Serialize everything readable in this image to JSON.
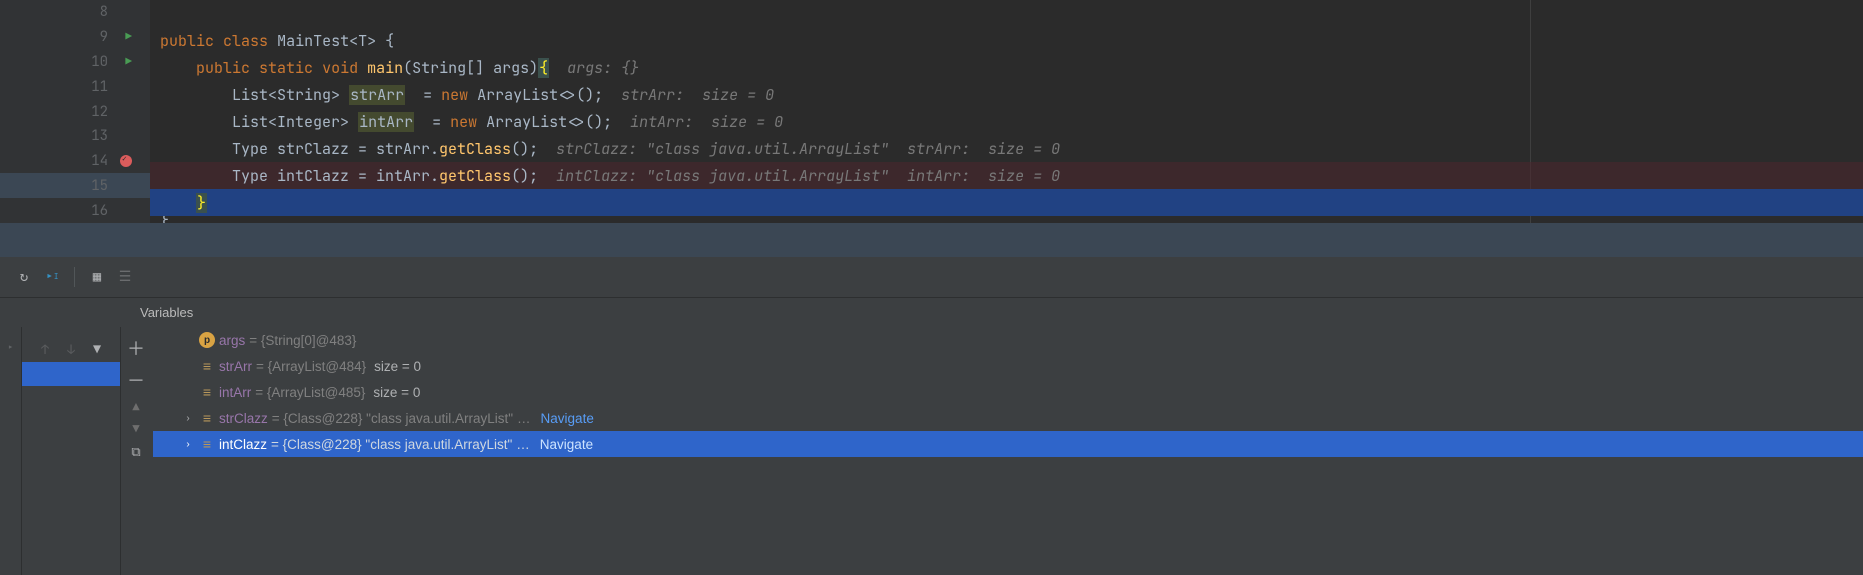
{
  "editor": {
    "lines": [
      {
        "num": "8",
        "run": false,
        "bp": false,
        "sel": false
      },
      {
        "num": "9",
        "run": true,
        "bp": false,
        "sel": false
      },
      {
        "num": "10",
        "run": true,
        "bp": false,
        "sel": false
      },
      {
        "num": "11",
        "run": false,
        "bp": false,
        "sel": false
      },
      {
        "num": "12",
        "run": false,
        "bp": false,
        "sel": false
      },
      {
        "num": "13",
        "run": false,
        "bp": false,
        "sel": false
      },
      {
        "num": "14",
        "run": false,
        "bp": true,
        "sel": false
      },
      {
        "num": "15",
        "run": false,
        "bp": false,
        "sel": true
      },
      {
        "num": "16",
        "run": false,
        "bp": false,
        "sel": false
      }
    ],
    "tokens": {
      "kw_public": "public",
      "kw_class": "class",
      "cls_main": "MainTest",
      "generic_t": "<T>",
      "ob": "{",
      "kw_static": "static",
      "kw_void": "void",
      "m_main": "main",
      "args_sig": "(String[] args)",
      "ob2": "{",
      "hint_args": "  args: {}",
      "t_list": "List",
      "t_string": "<String>",
      "sp": " ",
      "v_strArr": "strArr",
      "eq": "  = ",
      "kw_new": "new",
      "t_arraylist": " ArrayList<>();",
      "hint_strArr": "  strArr:  size = 0",
      "t_integer": "<Integer>",
      "v_intArr": "intArr",
      "hint_intArr": "  intArr:  size = 0",
      "t_type": "Type ",
      "v_strClazz": "strClazz = strArr.",
      "m_getclass": "getClass",
      "paren": "();",
      "hint_strClazz": "  strClazz: \"class java.util.ArrayList\"  strArr:  size = 0",
      "v_intClazz": "intClazz = intArr.",
      "hint_intClazz": "  intClazz: \"class java.util.ArrayList\"  intArr:  size = 0",
      "cb": "}",
      "cb2": "}"
    }
  },
  "vars_header": "Variables",
  "variables": [
    {
      "icon": "p",
      "name": "args",
      "value": " = {String[0]@483}",
      "extra": "",
      "expand": false,
      "nav": false
    },
    {
      "icon": "list",
      "name": "strArr",
      "value": " = {ArrayList@484} ",
      "extra": " size = 0",
      "expand": false,
      "nav": false
    },
    {
      "icon": "list",
      "name": "intArr",
      "value": " = {ArrayList@485} ",
      "extra": " size = 0",
      "expand": false,
      "nav": false
    },
    {
      "icon": "list",
      "name": "strClazz",
      "value": " = {Class@228} \"class java.util.ArrayList\"",
      "extra": "",
      "expand": true,
      "nav": true,
      "navtext": "Navigate",
      "ell": "…"
    },
    {
      "icon": "list",
      "name": "intClazz",
      "value": " = {Class@228} \"class java.util.ArrayList\"",
      "extra": "",
      "expand": true,
      "nav": true,
      "navtext": "Navigate",
      "ell": "…",
      "selected": true
    }
  ]
}
